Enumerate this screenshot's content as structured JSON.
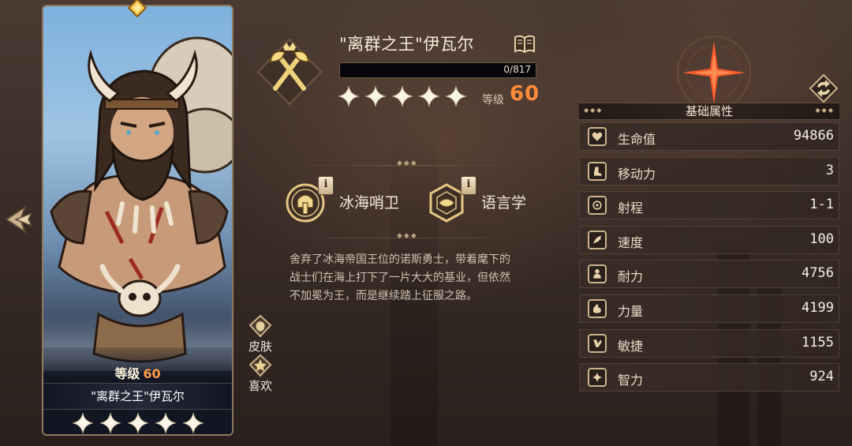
{
  "hero": {
    "title": "\"离群之王\"伊瓦尔",
    "exp_text": "0/817",
    "exp_fraction": 0,
    "star_count": 5,
    "level_label": "等级",
    "level_value": "60",
    "class_icon": "crossed-axes-icon"
  },
  "card": {
    "level_label": "等级",
    "level_value": "60",
    "name": "\"离群之王\"伊瓦尔",
    "star_count": 5
  },
  "side_buttons": {
    "skin_label": "皮肤",
    "like_label": "喜欢"
  },
  "skills": [
    {
      "label": "冰海哨卫",
      "icon": "helmet-shield-icon",
      "info": "i"
    },
    {
      "label": "语言学",
      "icon": "crest-emblem-icon",
      "info": "i"
    }
  ],
  "description": "舍弃了冰海帝国王位的诺斯勇士，带着麾下的战士们在海上打下了一片大大的基业，但依然不加冕为王，而是继续踏上征服之路。",
  "stats": {
    "title": "基础属性",
    "rows": [
      {
        "icon": "heart-icon",
        "label": "生命值",
        "value": "94866"
      },
      {
        "icon": "boot-icon",
        "label": "移动力",
        "value": "3"
      },
      {
        "icon": "target-icon",
        "label": "射程",
        "value": "1-1"
      },
      {
        "icon": "wing-icon",
        "label": "速度",
        "value": "100"
      },
      {
        "icon": "person-icon",
        "label": "耐力",
        "value": "4756"
      },
      {
        "icon": "arm-icon",
        "label": "力量",
        "value": "4199"
      },
      {
        "icon": "agility-icon",
        "label": "敏捷",
        "value": "1155"
      },
      {
        "icon": "sparkle-icon",
        "label": "智力",
        "value": "924"
      }
    ]
  },
  "colors": {
    "accent_orange": "#ff8a3a",
    "gold": "#e8cc8a",
    "compass_red": "#ff5a2a"
  }
}
